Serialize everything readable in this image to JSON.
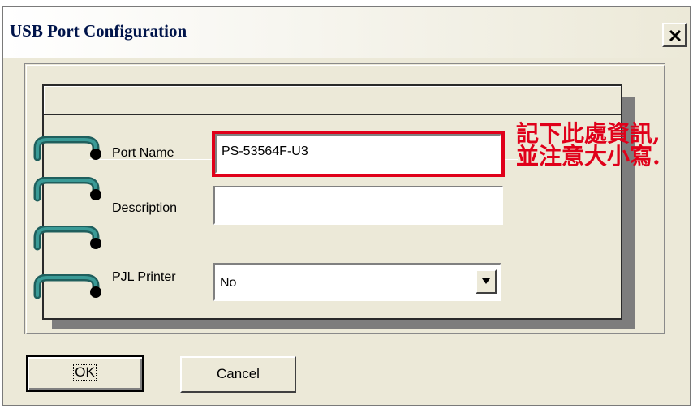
{
  "window": {
    "title": "USB Port Configuration",
    "close_icon": "close-x-icon"
  },
  "form": {
    "port_name_label": "Port Name",
    "port_name_value": "PS-53564F-U3",
    "description_label": "Description",
    "description_value": "",
    "pjl_printer_label": "PJL Printer",
    "pjl_printer_value": "No"
  },
  "annotation": {
    "line1": "記下此處資訊,",
    "line2": "並注意大小寫.",
    "color": "#e0001a"
  },
  "buttons": {
    "ok_label": "OK",
    "cancel_label": "Cancel"
  },
  "colors": {
    "dialog_bg": "#ece9d8",
    "ring": "#2e7f7c",
    "title_text": "#00144a"
  }
}
